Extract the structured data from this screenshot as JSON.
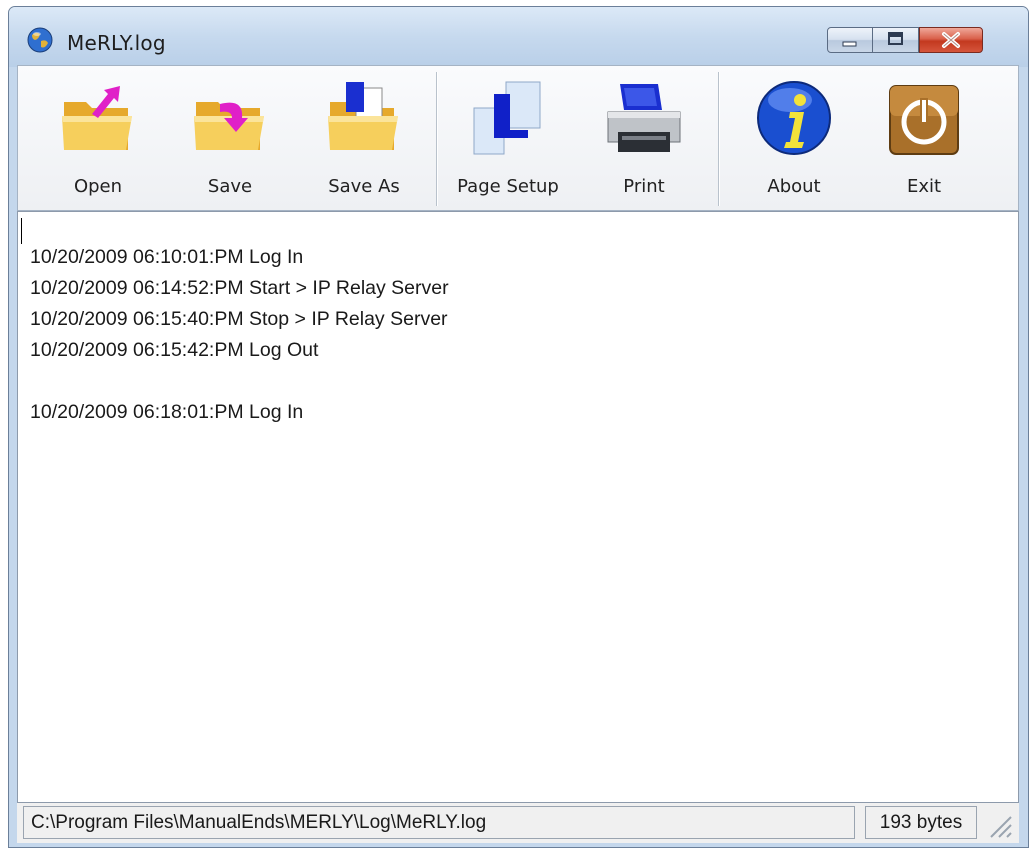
{
  "window": {
    "title": "MeRLY.log",
    "app_icon": "globe-icon",
    "controls": [
      "minimize-icon",
      "maximize-icon",
      "close-icon"
    ]
  },
  "toolbar": {
    "buttons": [
      {
        "label": "Open",
        "icon": "folder-open-icon"
      },
      {
        "label": "Save",
        "icon": "folder-save-icon"
      },
      {
        "label": "Save As",
        "icon": "folder-save-as-icon"
      },
      {
        "label": "Page Setup",
        "icon": "page-setup-icon"
      },
      {
        "label": "Print",
        "icon": "printer-icon"
      },
      {
        "label": "About",
        "icon": "info-icon"
      },
      {
        "label": "Exit",
        "icon": "power-icon"
      }
    ]
  },
  "editor": {
    "lines": [
      "10/20/2009 06:10:01:PM Log In",
      "10/20/2009 06:14:52:PM Start > IP Relay Server",
      "10/20/2009 06:15:40:PM Stop > IP Relay Server",
      "10/20/2009 06:15:42:PM Log Out",
      "",
      "10/20/2009 06:18:01:PM Log In"
    ]
  },
  "statusbar": {
    "path": "C:\\Program Files\\ManualEnds\\MERLY\\Log\\MeRLY.log",
    "size": "193 bytes"
  },
  "colors": {
    "titlebar": "#c6d9ee",
    "close_button": "#c3391f",
    "folder": "#f2c04a",
    "arrow_magenta": "#e020c8",
    "info_blue": "#1a4fd0"
  }
}
